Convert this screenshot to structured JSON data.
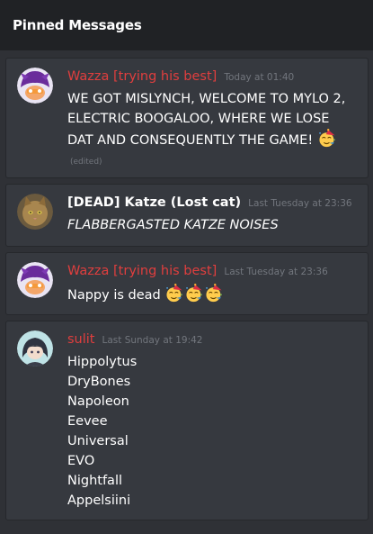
{
  "header": {
    "title": "Pinned Messages"
  },
  "messages": [
    {
      "author": "Wazza [trying his best]",
      "timestamp": "Today at 01:40",
      "text": "WE GOT MISLYNCH, WELCOME TO MYLO 2, ELECTRIC BOOGALOO, WHERE WE LOSE DAT AND CONSEQUENTLY THE GAME!",
      "edited": "(edited)",
      "emoji": [
        "partying-face"
      ]
    },
    {
      "author": "[DEAD] Katze (Lost cat)",
      "timestamp": "Last Tuesday at 23:36",
      "text": "FLABBERGASTED KATZE NOISES"
    },
    {
      "author": "Wazza [trying his best]",
      "timestamp": "Last Tuesday at 23:36",
      "text": "Nappy is dead",
      "emoji": [
        "partying-face",
        "partying-face",
        "partying-face"
      ]
    },
    {
      "author": "sulit",
      "timestamp": "Last Sunday at 19:42",
      "lines": [
        "Hippolytus",
        "DryBones",
        "Napoleon",
        "Eevee",
        "Universal",
        "EVO",
        "Nightfall",
        "Appelsiini"
      ]
    }
  ],
  "colors": {
    "author_red": "#e03e3e",
    "timestamp": "#72767d",
    "card_bg": "#36393f",
    "list_bg": "#2f3136",
    "header_bg": "#202225"
  }
}
